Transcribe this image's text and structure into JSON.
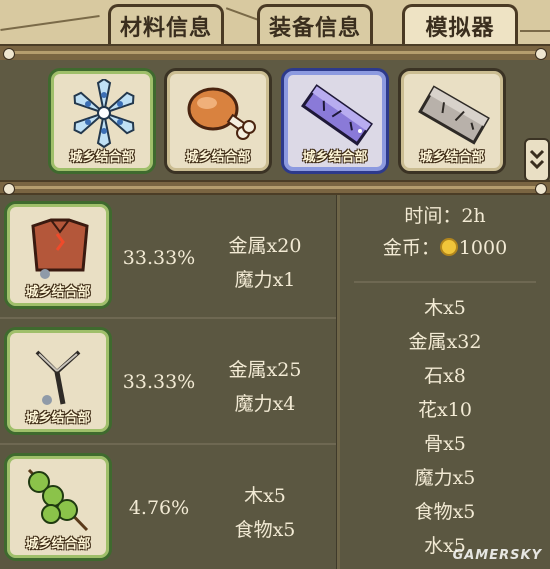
{
  "tabs": [
    {
      "label": "材料信息"
    },
    {
      "label": "装备信息"
    },
    {
      "label": "模拟器"
    }
  ],
  "watermark": "城乡结合部",
  "selection": [
    {
      "icon": "blue-flower-icon",
      "state": "green"
    },
    {
      "icon": "drumstick-icon",
      "state": "normal"
    },
    {
      "icon": "purple-crystal-bar-icon",
      "state": "selected"
    },
    {
      "icon": "stone-block-icon",
      "state": "normal"
    }
  ],
  "results": [
    {
      "icon": "armor-chest-icon",
      "chance": "33.33%",
      "materials": [
        "金属x20",
        "魔力x1"
      ]
    },
    {
      "icon": "fork-icon",
      "chance": "33.33%",
      "materials": [
        "金属x25",
        "魔力x4"
      ]
    },
    {
      "icon": "pea-skewer-icon",
      "chance": "4.76%",
      "materials": [
        "木x5",
        "食物x5"
      ]
    }
  ],
  "summary": {
    "time": "时间：2h",
    "gold_label": "金币：",
    "gold_value": "1000"
  },
  "totals": [
    "木x5",
    "金属x32",
    "石x8",
    "花x10",
    "骨x5",
    "魔力x5",
    "食物x5",
    "水x5"
  ],
  "source_watermark": "GAMERSKY",
  "colors": {
    "green_frame": "#3f6a2e",
    "selected_frame": "#2d3a8c",
    "panel_bg": "#5b5741"
  }
}
